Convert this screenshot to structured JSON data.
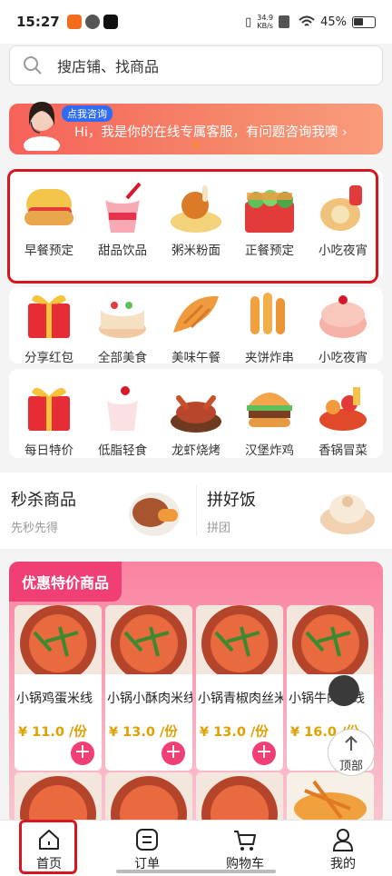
{
  "status_bar": {
    "time": "15:27",
    "speed_value": "34.9",
    "speed_unit": "KB/s",
    "battery": "45%"
  },
  "search": {
    "placeholder": "搜店铺、找商品"
  },
  "banner": {
    "tag": "点我咨询",
    "text": "Hi，我是你的在线专属客服，有问题咨询我噢 ›"
  },
  "category_rows": [
    {
      "items": [
        {
          "label": "早餐预定",
          "icon": "hotdog-icon"
        },
        {
          "label": "甜品饮品",
          "icon": "drink-cup-icon"
        },
        {
          "label": "粥米粉面",
          "icon": "noodle-chicken-icon"
        },
        {
          "label": "正餐预定",
          "icon": "bento-box-icon"
        },
        {
          "label": "小吃夜宵",
          "icon": "roll-cake-icon"
        }
      ]
    },
    {
      "items": [
        {
          "label": "分享红包",
          "icon": "gift-box-icon"
        },
        {
          "label": "全部美食",
          "icon": "cake-icon"
        },
        {
          "label": "美味午餐",
          "icon": "croissant-icon"
        },
        {
          "label": "夹饼炸串",
          "icon": "fries-icon"
        },
        {
          "label": "小吃夜宵",
          "icon": "macaron-icon"
        }
      ]
    },
    {
      "items": [
        {
          "label": "每日特价",
          "icon": "gift-box-icon"
        },
        {
          "label": "低脂轻食",
          "icon": "milk-cup-icon"
        },
        {
          "label": "龙虾烧烤",
          "icon": "crayfish-icon"
        },
        {
          "label": "汉堡炸鸡",
          "icon": "burger-icon"
        },
        {
          "label": "香锅冒菜",
          "icon": "spicy-pot-icon"
        }
      ]
    }
  ],
  "promos": [
    {
      "title": "秒杀商品",
      "subtitle": "先秒先得"
    },
    {
      "title": "拼好饭",
      "subtitle": "拼团"
    }
  ],
  "deals": {
    "title": "优惠特价商品",
    "products": [
      {
        "name": "小锅鸡蛋米线",
        "price": "¥ 11.0 /份"
      },
      {
        "name": "小锅小酥肉米线",
        "price": "¥ 13.0 /份"
      },
      {
        "name": "小锅青椒肉丝米线",
        "price": "¥ 13.0 /份"
      },
      {
        "name": "小锅牛肉米线",
        "price": "¥ 16.0 /份"
      }
    ]
  },
  "top_button": {
    "label": "顶部"
  },
  "tabbar": [
    {
      "label": "首页",
      "icon": "home-icon"
    },
    {
      "label": "订单",
      "icon": "order-icon"
    },
    {
      "label": "购物车",
      "icon": "cart-icon"
    },
    {
      "label": "我的",
      "icon": "user-icon"
    }
  ],
  "colors": {
    "accent": "#ef3f74",
    "highlight_border": "#d7161f",
    "price": "#e0a000",
    "banner": "#f6625a"
  }
}
